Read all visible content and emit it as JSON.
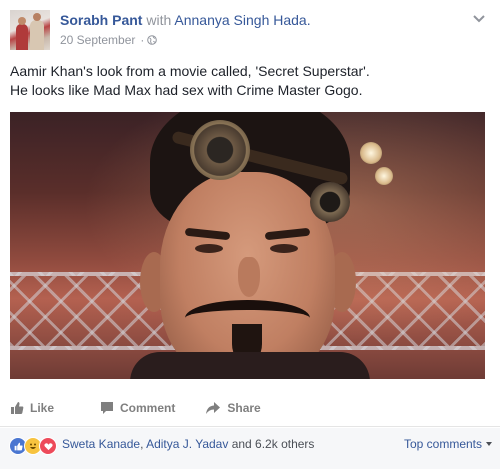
{
  "post": {
    "author": "Sorabh Pant",
    "with_word": "with",
    "tagged": "Annanya Singh Hada.",
    "date": "20 September",
    "separator": "·",
    "text_lines": [
      "Aamir Khan's look from a movie called, 'Secret Superstar'.",
      "He looks like Mad Max had sex with Crime Master Gogo."
    ],
    "privacy_icon": "globe-icon"
  },
  "actions": {
    "like": "Like",
    "comment": "Comment",
    "share": "Share"
  },
  "reactions": {
    "icons": [
      "like-reaction-icon",
      "haha-reaction-icon",
      "love-reaction-icon"
    ],
    "name1": "Sweta Kanade",
    "comma": ", ",
    "name2": "Aditya J. Yadav",
    "and_others": " and 6.2k others",
    "sort_label": "Top comments"
  },
  "colors": {
    "link": "#365899",
    "meta": "#90949c",
    "reaction_bar": "#f6f7f9"
  }
}
